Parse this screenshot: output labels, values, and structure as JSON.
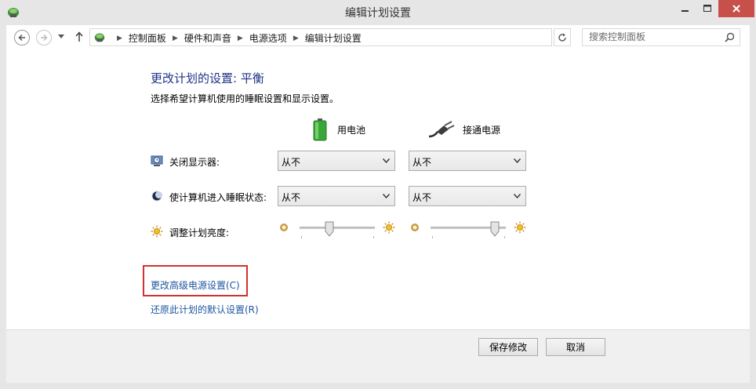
{
  "window": {
    "title": "编辑计划设置"
  },
  "address": {
    "crumbs": [
      "控制面板",
      "硬件和声音",
      "电源选项",
      "编辑计划设置"
    ]
  },
  "search": {
    "placeholder": "搜索控制面板"
  },
  "main": {
    "heading": "更改计划的设置: 平衡",
    "subtitle": "选择希望计算机使用的睡眠设置和显示设置。",
    "columns": {
      "battery": "用电池",
      "ac": "接通电源"
    },
    "rows": {
      "display_off": {
        "label": "关闭显示器:",
        "battery_value": "从不",
        "ac_value": "从不"
      },
      "sleep": {
        "label": "使计算机进入睡眠状态:",
        "battery_value": "从不",
        "ac_value": "从不"
      },
      "brightness": {
        "label": "调整计划亮度:",
        "battery_level": 0.4,
        "ac_level": 0.85
      }
    },
    "links": {
      "advanced": "更改高级电源设置(C)",
      "restore": "还原此计划的默认设置(R)"
    }
  },
  "footer": {
    "save": "保存修改",
    "cancel": "取消"
  },
  "colors": {
    "link": "#1e56a0",
    "heading": "#1e3287",
    "highlight_box": "#d0342c",
    "close_button": "#c7504a"
  }
}
